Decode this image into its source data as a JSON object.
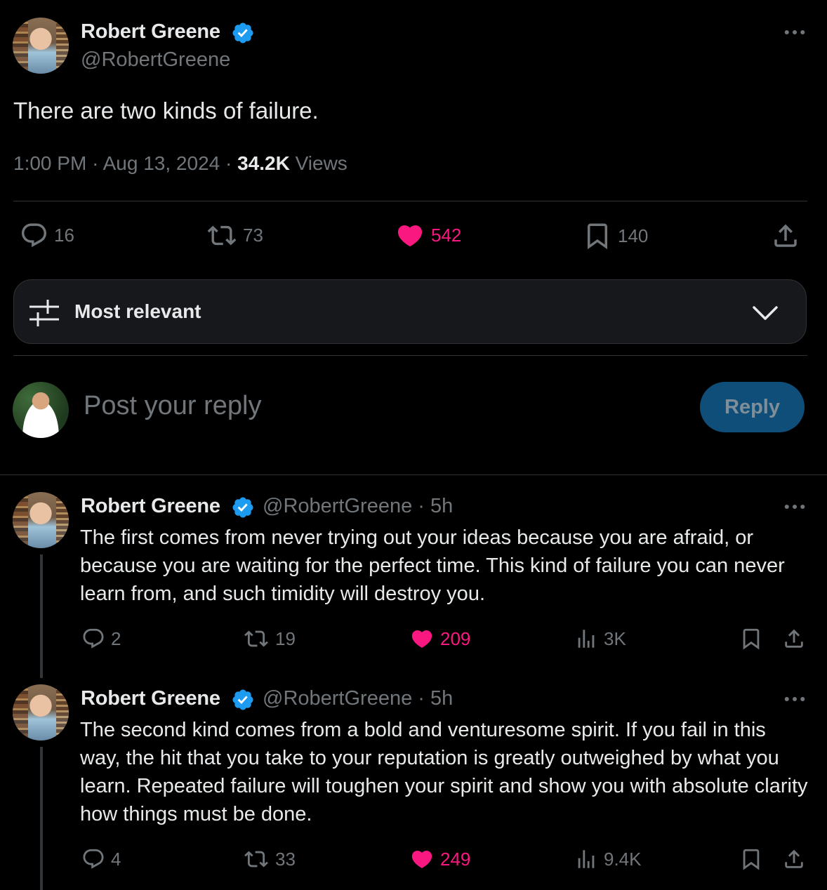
{
  "tweet": {
    "name": "Robert Greene",
    "handle": "@RobertGreene",
    "text": "There are two kinds of failure.",
    "time": "1:00 PM",
    "date": "Aug 13, 2024",
    "views_count": "34.2K",
    "views_label": "Views",
    "replies": "16",
    "retweets": "73",
    "likes": "542",
    "bookmarks": "140"
  },
  "sort": {
    "label": "Most relevant"
  },
  "composer": {
    "placeholder": "Post your reply",
    "button": "Reply"
  },
  "replies": [
    {
      "name": "Robert Greene",
      "handle": "@RobertGreene",
      "time": "5h",
      "text": "The first comes from never trying out your ideas because you are afraid, or because you are waiting for the perfect time. This kind of failure you can never learn from, and such timidity will destroy you.",
      "replies": "2",
      "retweets": "19",
      "likes": "209",
      "views": "3K"
    },
    {
      "name": "Robert Greene",
      "handle": "@RobertGreene",
      "time": "5h",
      "text": "The second kind comes from a bold and venturesome spirit. If you fail in this way, the hit that you take to your reputation is greatly outweighed by what you learn. Repeated failure will toughen your spirit and show you with absolute clarity how things must be done.",
      "replies": "4",
      "retweets": "33",
      "likes": "249",
      "views": "9.4K"
    }
  ],
  "colors": {
    "accent": "#1d9bf0",
    "like": "#f91880",
    "muted": "#71767b",
    "border": "#2f3336"
  },
  "icons": [
    "verified-badge-icon",
    "more-icon",
    "reply-icon",
    "retweet-icon",
    "heart-icon",
    "bookmark-icon",
    "share-icon",
    "views-icon",
    "sliders-icon",
    "chevron-down-icon"
  ]
}
